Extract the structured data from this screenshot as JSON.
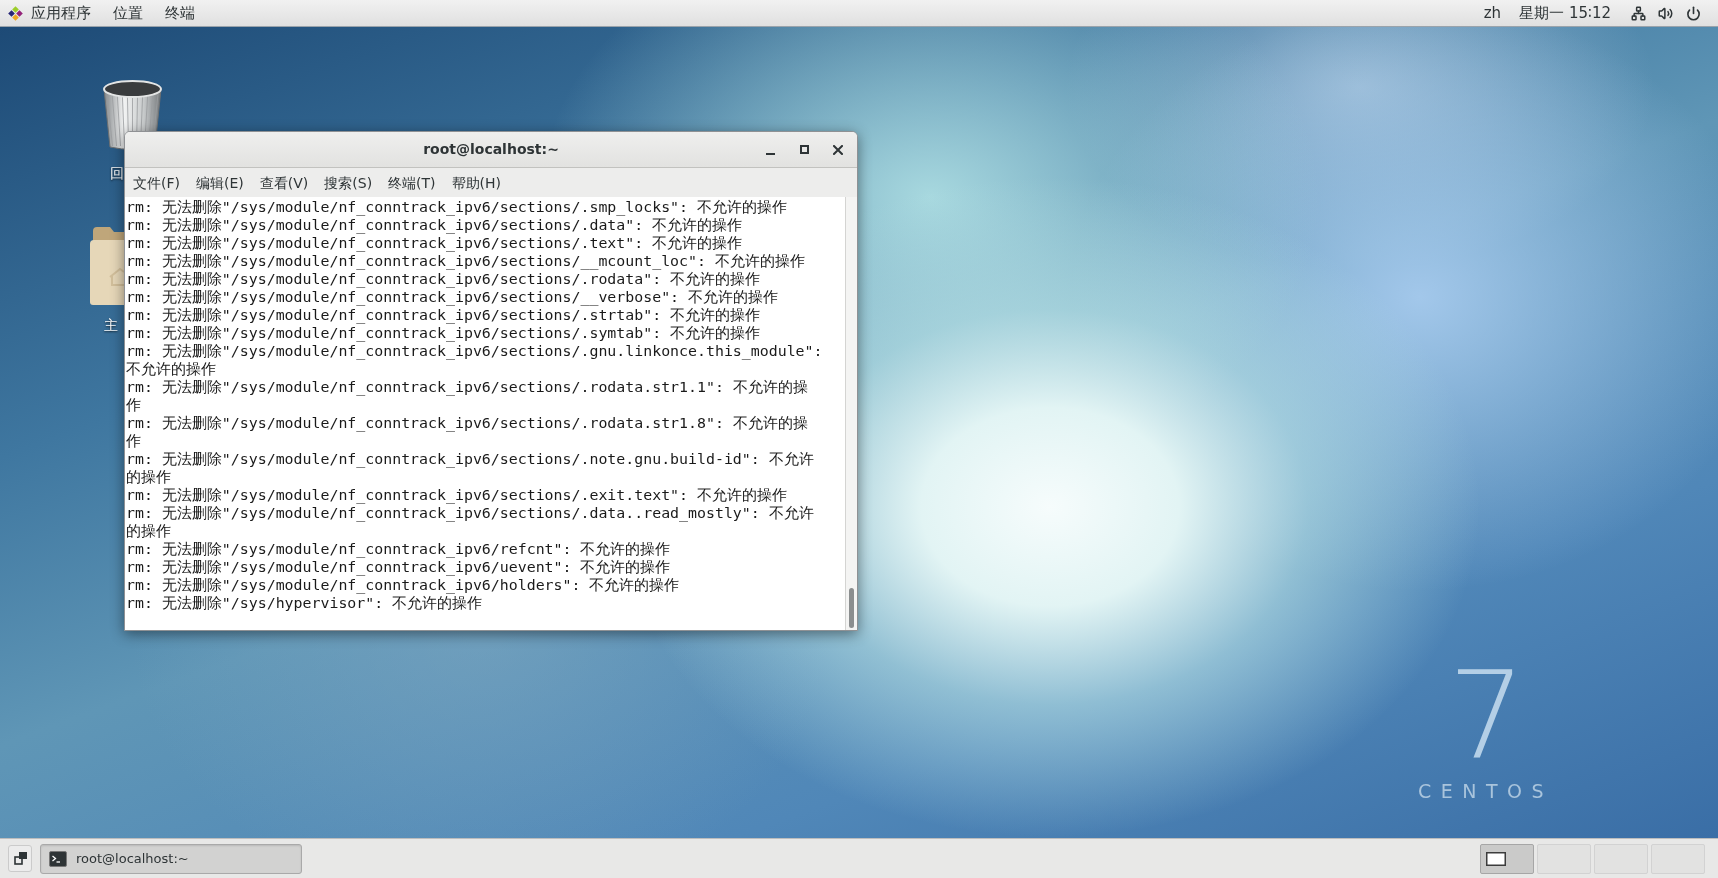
{
  "top_bar": {
    "menus": [
      "应用程序",
      "位置",
      "终端"
    ],
    "input_method": "zh",
    "clock": "星期一 15∶12"
  },
  "desktop": {
    "icons": [
      {
        "kind": "trash",
        "label": "回"
      },
      {
        "kind": "folder",
        "label": "主"
      }
    ],
    "logo": {
      "numeral": "7",
      "wordmark": "CENTOS"
    }
  },
  "window": {
    "title": "root@localhost:~",
    "menu": [
      "文件(F)",
      "编辑(E)",
      "查看(V)",
      "搜索(S)",
      "终端(T)",
      "帮助(H)"
    ],
    "terminal_lines": [
      "rm: 无法删除\"/sys/module/nf_conntrack_ipv6/sections/.smp_locks\": 不允许的操作",
      "rm: 无法删除\"/sys/module/nf_conntrack_ipv6/sections/.data\": 不允许的操作",
      "rm: 无法删除\"/sys/module/nf_conntrack_ipv6/sections/.text\": 不允许的操作",
      "rm: 无法删除\"/sys/module/nf_conntrack_ipv6/sections/__mcount_loc\": 不允许的操作",
      "rm: 无法删除\"/sys/module/nf_conntrack_ipv6/sections/.rodata\": 不允许的操作",
      "rm: 无法删除\"/sys/module/nf_conntrack_ipv6/sections/__verbose\": 不允许的操作",
      "rm: 无法删除\"/sys/module/nf_conntrack_ipv6/sections/.strtab\": 不允许的操作",
      "rm: 无法删除\"/sys/module/nf_conntrack_ipv6/sections/.symtab\": 不允许的操作",
      "rm: 无法删除\"/sys/module/nf_conntrack_ipv6/sections/.gnu.linkonce.this_module\":",
      "不允许的操作",
      "rm: 无法删除\"/sys/module/nf_conntrack_ipv6/sections/.rodata.str1.1\": 不允许的操",
      "作",
      "rm: 无法删除\"/sys/module/nf_conntrack_ipv6/sections/.rodata.str1.8\": 不允许的操",
      "作",
      "rm: 无法删除\"/sys/module/nf_conntrack_ipv6/sections/.note.gnu.build-id\": 不允许",
      "的操作",
      "rm: 无法删除\"/sys/module/nf_conntrack_ipv6/sections/.exit.text\": 不允许的操作",
      "rm: 无法删除\"/sys/module/nf_conntrack_ipv6/sections/.data..read_mostly\": 不允许",
      "的操作",
      "rm: 无法删除\"/sys/module/nf_conntrack_ipv6/refcnt\": 不允许的操作",
      "rm: 无法删除\"/sys/module/nf_conntrack_ipv6/uevent\": 不允许的操作",
      "rm: 无法删除\"/sys/module/nf_conntrack_ipv6/holders\": 不允许的操作",
      "rm: 无法删除\"/sys/hypervisor\": 不允许的操作"
    ]
  },
  "taskbar": {
    "tasks": [
      {
        "label": "root@localhost:~",
        "selected": true
      }
    ],
    "workspaces": [
      {
        "selected": true
      },
      {
        "selected": false
      },
      {
        "selected": false
      },
      {
        "selected": false
      }
    ]
  }
}
